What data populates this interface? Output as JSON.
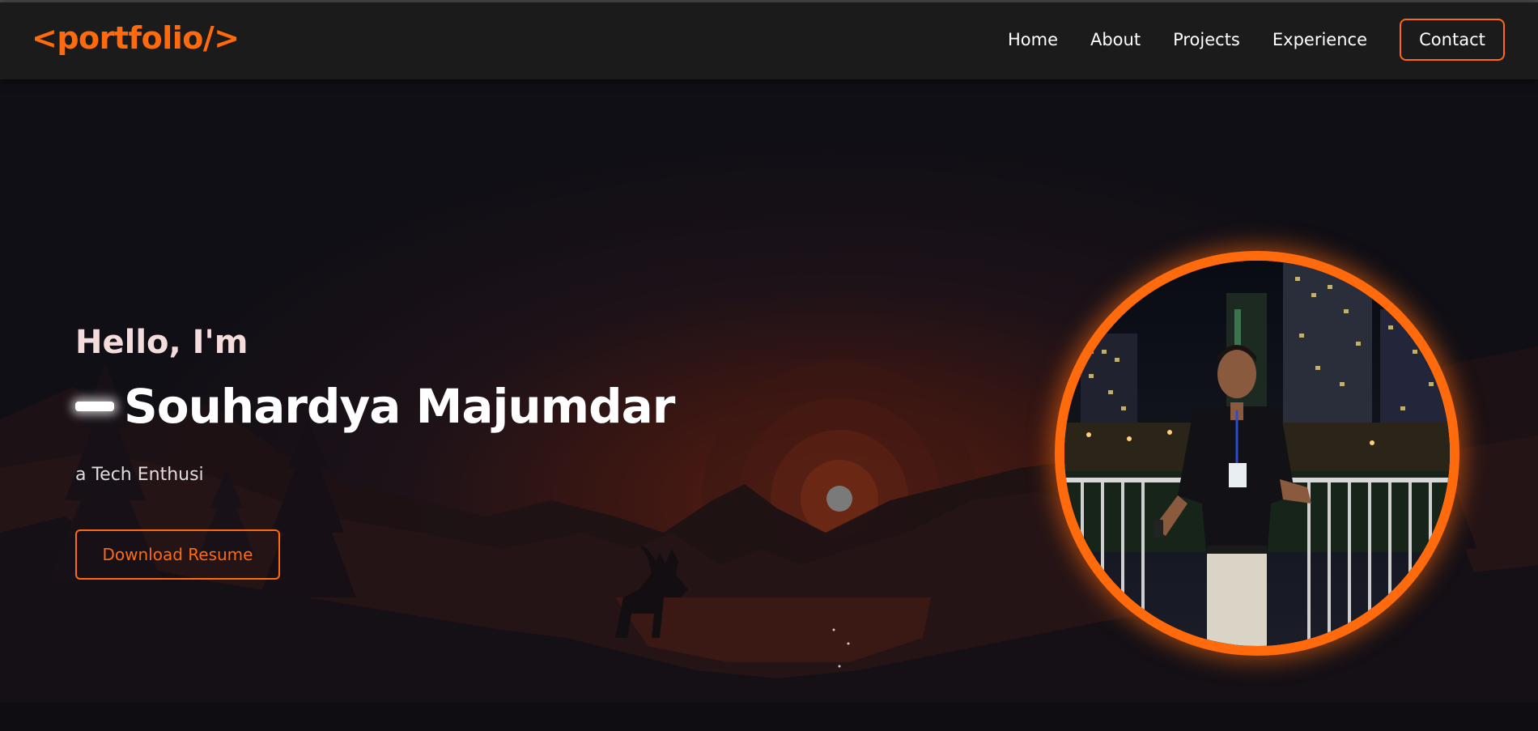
{
  "brand": {
    "logo": "<portfolio/>"
  },
  "nav": {
    "items": [
      {
        "label": "Home"
      },
      {
        "label": "About"
      },
      {
        "label": "Projects"
      },
      {
        "label": "Experience"
      }
    ],
    "contact_label": "Contact"
  },
  "hero": {
    "greeting": "Hello, I'm",
    "name": "Souhardya Majumdar",
    "subtitle": "a Tech Enthusi",
    "resume_label": "Download Resume",
    "profile_image": "profile-photo"
  },
  "colors": {
    "accent": "#ff6a0d",
    "navbar": "#1b1b1b",
    "background": "#0f0e14"
  }
}
